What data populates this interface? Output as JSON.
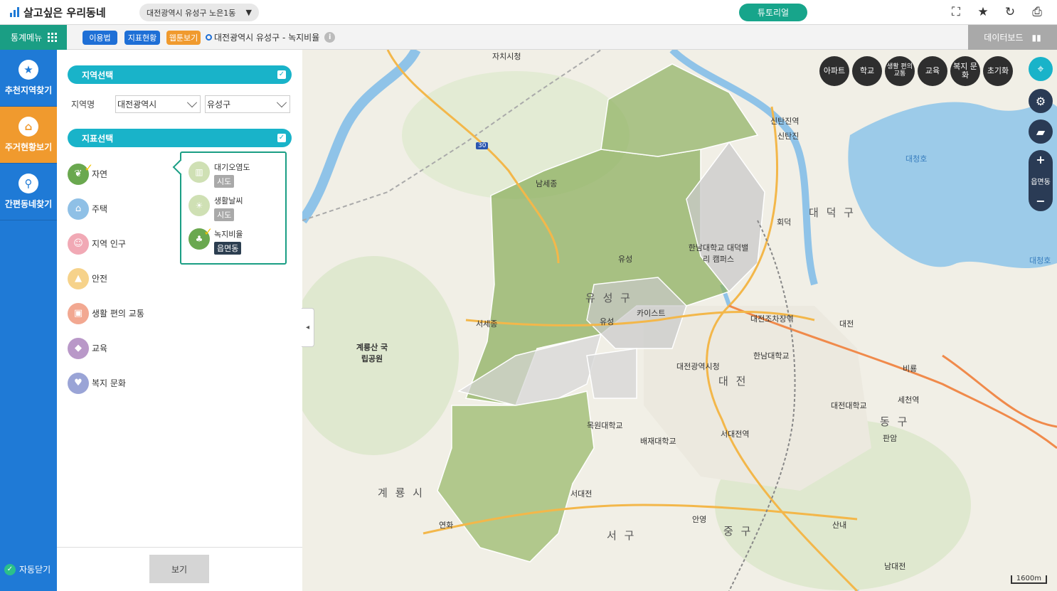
{
  "app": {
    "title": "살고싶은 우리동네"
  },
  "header": {
    "location_select": "대전광역시 유성구 노은1동",
    "tutorial_label": "튜토리얼",
    "icons": [
      "fullscreen-icon",
      "star-icon",
      "refresh-icon",
      "print-icon"
    ]
  },
  "subbar": {
    "menu_label": "통계메뉴",
    "pills": {
      "usage": "이용법",
      "status": "지표현황",
      "webtoon": "웹툰보기"
    },
    "path": "대전광역시 유성구 - 녹지비율",
    "info_label": "i",
    "dashboard_label": "데이터보드"
  },
  "nav": {
    "items": [
      {
        "label": "추천지역찾기",
        "icon": "star-icon"
      },
      {
        "label": "주거현황보기",
        "icon": "house-icon"
      },
      {
        "label": "간편동네찾기",
        "icon": "search-icon"
      }
    ],
    "autoclose_label": "자동닫기"
  },
  "panel": {
    "region_header": "지역선택",
    "region_label": "지역명",
    "sido_value": "대전광역시",
    "sigungu_value": "유성구",
    "indicator_header": "지표선택",
    "indicators": [
      {
        "label": "자연",
        "color": "#6aa84f",
        "checked": true
      },
      {
        "label": "주택",
        "color": "#8fc0e6",
        "checked": false
      },
      {
        "label": "지역 인구",
        "color": "#f1a9b5",
        "checked": false
      },
      {
        "label": "안전",
        "color": "#f6d28a",
        "checked": false
      },
      {
        "label": "생활 편의 교통",
        "color": "#f2a891",
        "checked": false
      },
      {
        "label": "교육",
        "color": "#b998c8",
        "checked": false
      },
      {
        "label": "복지 문화",
        "color": "#9aa4d6",
        "checked": false
      }
    ],
    "sub_indicators": [
      {
        "label": "대기오염도",
        "tag": "시도",
        "active": false
      },
      {
        "label": "생활날씨",
        "tag": "시도",
        "active": false
      },
      {
        "label": "녹지비율",
        "tag": "읍면동",
        "active": true
      }
    ],
    "view_button": "보기"
  },
  "map": {
    "poi_buttons": [
      "아파트",
      "학교",
      "생활 편의 교통",
      "교육",
      "복지 문화",
      "초기화"
    ],
    "zoom_label": "읍면동",
    "scale_label": "1600m",
    "labels": [
      {
        "text": "자치시청",
        "style": "normal"
      },
      {
        "text": "신탄진역",
        "style": "normal"
      },
      {
        "text": "신탄진",
        "style": "normal"
      },
      {
        "text": "남세종",
        "style": "normal"
      },
      {
        "text": "대청호",
        "style": "blue"
      },
      {
        "text": "대 덕 구",
        "style": "big"
      },
      {
        "text": "회덕",
        "style": "normal"
      },
      {
        "text": "한남대학교 대덕밸리 캠퍼스",
        "style": "normal"
      },
      {
        "text": "유성",
        "style": "normal"
      },
      {
        "text": "유 성 구",
        "style": "big"
      },
      {
        "text": "카이스트",
        "style": "normal"
      },
      {
        "text": "대청호",
        "style": "blue"
      },
      {
        "text": "대전조차장역",
        "style": "normal"
      },
      {
        "text": "대전",
        "style": "normal"
      },
      {
        "text": "유성",
        "style": "normal"
      },
      {
        "text": "서세종",
        "style": "normal"
      },
      {
        "text": "계룡산 국립공원",
        "style": "normal"
      },
      {
        "text": "한남대학교",
        "style": "normal"
      },
      {
        "text": "대전광역시청",
        "style": "normal"
      },
      {
        "text": "대 전",
        "style": "big"
      },
      {
        "text": "비룡",
        "style": "normal"
      },
      {
        "text": "대전대학교",
        "style": "normal"
      },
      {
        "text": "세천역",
        "style": "normal"
      },
      {
        "text": "목원대학교",
        "style": "normal"
      },
      {
        "text": "배재대학교",
        "style": "normal"
      },
      {
        "text": "서대전역",
        "style": "normal"
      },
      {
        "text": "동 구",
        "style": "big"
      },
      {
        "text": "판암",
        "style": "normal"
      },
      {
        "text": "계 룡 시",
        "style": "big"
      },
      {
        "text": "서대전",
        "style": "normal"
      },
      {
        "text": "안영",
        "style": "normal"
      },
      {
        "text": "산내",
        "style": "normal"
      },
      {
        "text": "연화",
        "style": "normal"
      },
      {
        "text": "서 구",
        "style": "big"
      },
      {
        "text": "중 구",
        "style": "big"
      },
      {
        "text": "남대전",
        "style": "normal"
      },
      {
        "text": "30",
        "style": "normal"
      }
    ]
  }
}
